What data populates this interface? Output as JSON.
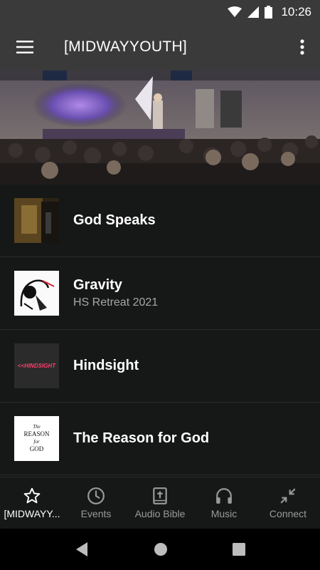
{
  "status": {
    "time": "10:26"
  },
  "app_bar": {
    "title": "[MIDWAYYOUTH]"
  },
  "list": [
    {
      "title": "God Speaks",
      "subtitle": ""
    },
    {
      "title": "Gravity",
      "subtitle": "HS Retreat 2021"
    },
    {
      "title": "Hindsight",
      "subtitle": "",
      "thumb_text": "<<HINDSIGHT"
    },
    {
      "title": "The Reason for God",
      "subtitle": "",
      "thumb_text": {
        "the": "The",
        "reason": "REASON",
        "for": "for",
        "god": "GOD"
      }
    }
  ],
  "bottom_nav": [
    {
      "label": "[MIDWAYY...",
      "icon": "star-icon",
      "active": true
    },
    {
      "label": "Events",
      "icon": "clock-icon",
      "active": false
    },
    {
      "label": "Audio Bible",
      "icon": "bible-icon",
      "active": false
    },
    {
      "label": "Music",
      "icon": "headphones-icon",
      "active": false
    },
    {
      "label": "Connect",
      "icon": "compress-icon",
      "active": false
    }
  ],
  "colors": {
    "app_bar": "#3a3a3a",
    "list_bg": "#161717",
    "accent_purple": "#6a4fb0",
    "inactive": "#9a9a9a"
  }
}
